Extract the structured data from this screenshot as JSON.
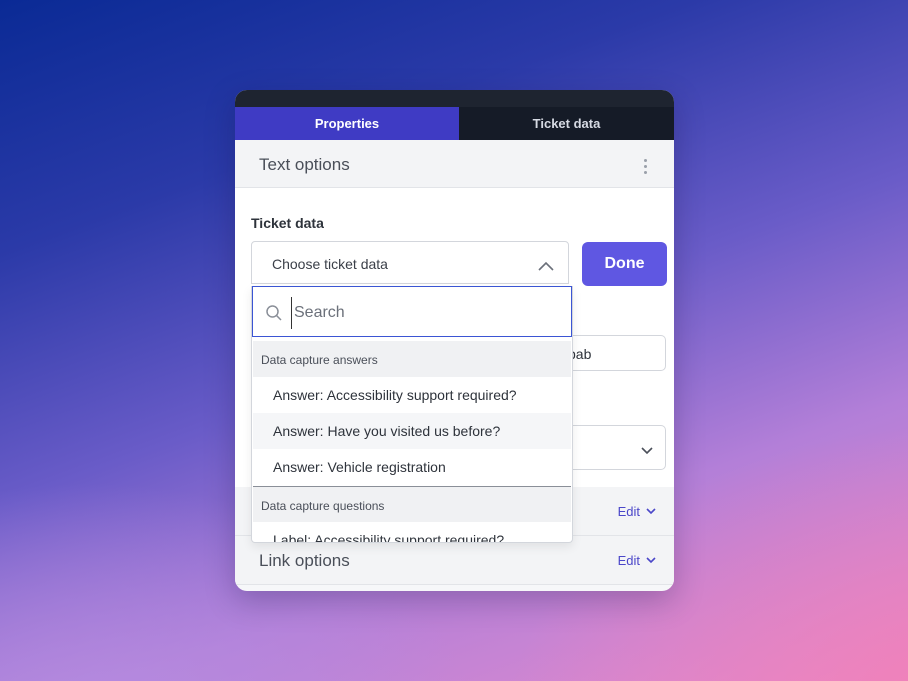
{
  "tabs": [
    {
      "label": "Properties",
      "active": true
    },
    {
      "label": "Ticket data",
      "active": false
    }
  ],
  "section": {
    "title": "Text options",
    "menu_icon": "kebab-menu-icon"
  },
  "ticket_data": {
    "label": "Ticket data",
    "select_value": "Choose ticket data",
    "done_label": "Done"
  },
  "search": {
    "placeholder": "Search",
    "value": ""
  },
  "dropdown": {
    "groups": [
      {
        "header": "Data capture answers",
        "options": [
          "Answer: Accessibility support required?",
          "Answer: Have you visited us before?",
          "Answer: Vehicle registration"
        ]
      },
      {
        "header": "Data capture questions",
        "options": [
          "Label: Accessibility support required?"
        ]
      }
    ]
  },
  "background_fields": {
    "input_partial_text": "bab"
  },
  "rows": [
    {
      "title": "",
      "edit_label": "Edit"
    },
    {
      "title": "Link options",
      "edit_label": "Edit"
    }
  ],
  "colors": {
    "accent": "#5f57e2",
    "tab_active": "#3f3bc4",
    "tab_inactive": "#151b27",
    "link": "#4b47c9",
    "focus_border": "#3b55d4"
  }
}
